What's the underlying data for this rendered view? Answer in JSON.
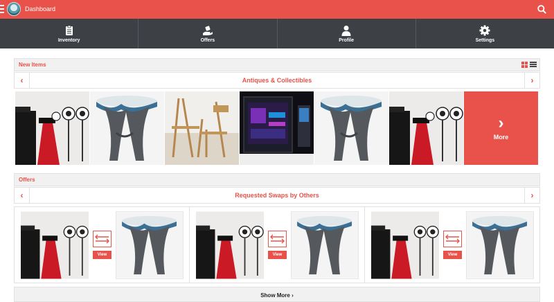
{
  "header": {
    "title": "Dashboard"
  },
  "nav": [
    {
      "label": "Inventory",
      "icon": "clipboard-icon"
    },
    {
      "label": "Offers",
      "icon": "offer-hand-icon"
    },
    {
      "label": "Profile",
      "icon": "person-icon"
    },
    {
      "label": "Settings",
      "icon": "gear-icon"
    }
  ],
  "new_items": {
    "label": "New Items",
    "category": "Antiques & Collectibles",
    "items": [
      "speakers",
      "sculpture",
      "chair",
      "computer",
      "sculpture",
      "speakers"
    ],
    "more_label": "More"
  },
  "offers": {
    "label": "Offers",
    "category": "Requested Swaps by Others",
    "cards": [
      {
        "view_label": "View"
      },
      {
        "view_label": "View"
      },
      {
        "view_label": "View"
      }
    ]
  },
  "show_more": "Show More",
  "colors": {
    "accent": "#e8524a",
    "nav_bg": "#3d4146"
  }
}
